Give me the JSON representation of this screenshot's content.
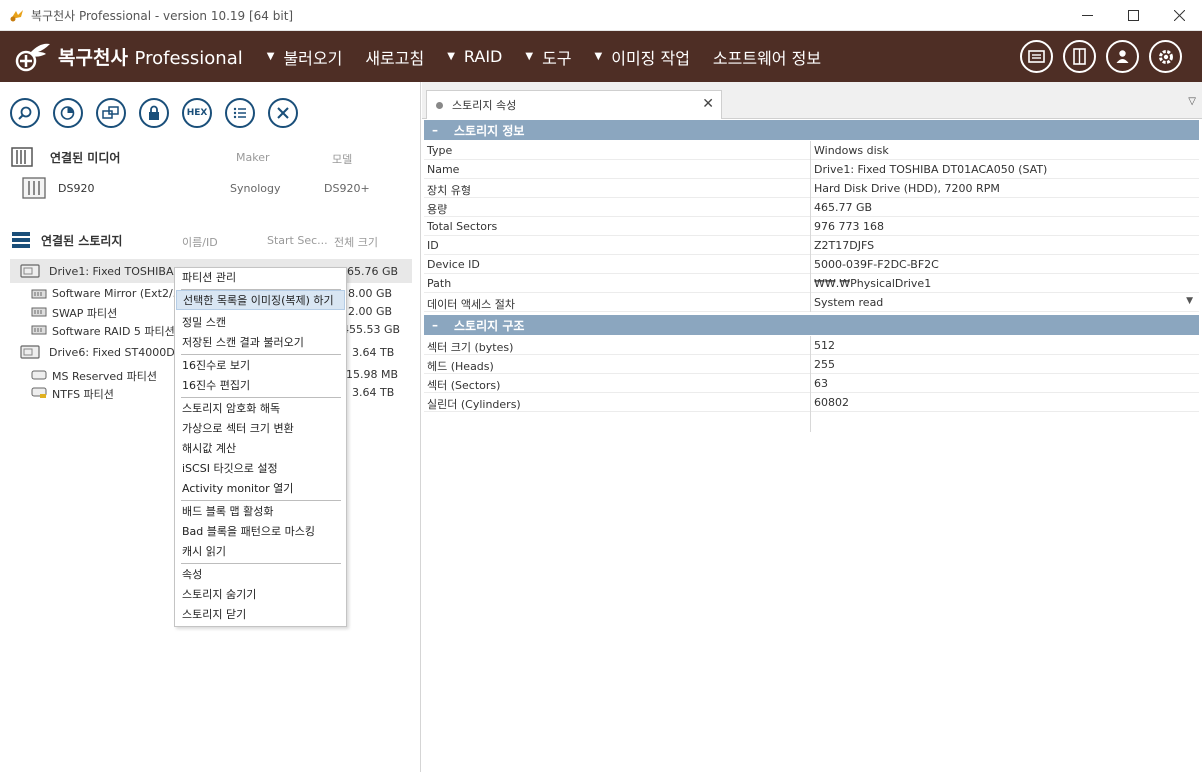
{
  "window": {
    "title": "복구천사 Professional - version 10.19 [64 bit]"
  },
  "menubar": {
    "brand": "복구천사",
    "brand_suffix": "Professional",
    "items": [
      {
        "label": "불러오기",
        "arrow": true
      },
      {
        "label": "새로고침",
        "arrow": false
      },
      {
        "label": "RAID",
        "arrow": true
      },
      {
        "label": "도구",
        "arrow": true
      },
      {
        "label": "이미징 작업",
        "arrow": true
      },
      {
        "label": "소프트웨어 정보",
        "arrow": false
      }
    ]
  },
  "toolbar": {
    "hex_label": "HEX"
  },
  "media": {
    "title": "연결된 미디어",
    "col_maker": "Maker",
    "col_model": "모델",
    "items": [
      {
        "name": "DS920",
        "maker": "Synology",
        "model": "DS920+"
      }
    ]
  },
  "storage": {
    "title": "연결된 스토리지",
    "col_name": "이름/ID",
    "col_start": "Start Sec...",
    "col_size": "전체 크기",
    "drives": [
      {
        "name": "Drive1: Fixed TOSHIBA ...",
        "size": "465.76 GB"
      },
      {
        "name": "Software Mirror (Ext2/...",
        "size": "8.00 GB"
      },
      {
        "name": "SWAP 파티션",
        "size": "2.00 GB"
      },
      {
        "name": "Software RAID 5 파티션",
        "size": "455.53 GB"
      },
      {
        "name": "Drive6: Fixed ST4000D...",
        "size": "3.64 TB"
      },
      {
        "name": "MS Reserved 파티션",
        "size": "15.98 MB"
      },
      {
        "name": "NTFS 파티션",
        "size": "3.64 TB"
      }
    ]
  },
  "context_menu": {
    "items": [
      "파티션 관리",
      "선택한 목록을 이미징(복제) 하기",
      "정밀 스캔",
      "저장된 스캔 결과 불러오기",
      "16진수로 보기",
      "16진수 편집기",
      "스토리지 암호화 해독",
      "가상으로 섹터 크기 변환",
      "해시값 계산",
      "iSCSI 타깃으로 설정",
      "Activity monitor 열기",
      "배드 블록 맵 활성화",
      "Bad 블록을 패턴으로 마스킹",
      "캐시 읽기",
      "속성",
      "스토리지 숨기기",
      "스토리지 닫기"
    ]
  },
  "tab": {
    "label": "스토리지 속성"
  },
  "properties": {
    "info_title": "스토리지 정보",
    "info": [
      {
        "k": "Type",
        "v": "Windows disk"
      },
      {
        "k": "Name",
        "v": "Drive1: Fixed TOSHIBA DT01ACA050 (SAT)"
      },
      {
        "k": "장치 유형",
        "v": "Hard Disk Drive (HDD), 7200 RPM"
      },
      {
        "k": "용량",
        "v": "465.77 GB"
      },
      {
        "k": "Total Sectors",
        "v": "976 773 168"
      },
      {
        "k": "ID",
        "v": "Z2T17DJFS"
      },
      {
        "k": "Device ID",
        "v": "5000-039F-F2DC-BF2C"
      },
      {
        "k": "Path",
        "v": "₩₩.₩PhysicalDrive1"
      },
      {
        "k": "데이터 액세스 절차",
        "v": "System read"
      }
    ],
    "struct_title": "스토리지 구조",
    "struct": [
      {
        "k": "섹터 크기 (bytes)",
        "v": "512"
      },
      {
        "k": "헤드 (Heads)",
        "v": "255"
      },
      {
        "k": "섹터 (Sectors)",
        "v": "63"
      },
      {
        "k": "실린더 (Cylinders)",
        "v": "60802"
      }
    ]
  },
  "colors": {
    "menubar_bg": "#4e2e25",
    "group_header": "#8ba6bf",
    "tool_icon": "#1a4f7a",
    "highlight": "#d9e6f3"
  }
}
